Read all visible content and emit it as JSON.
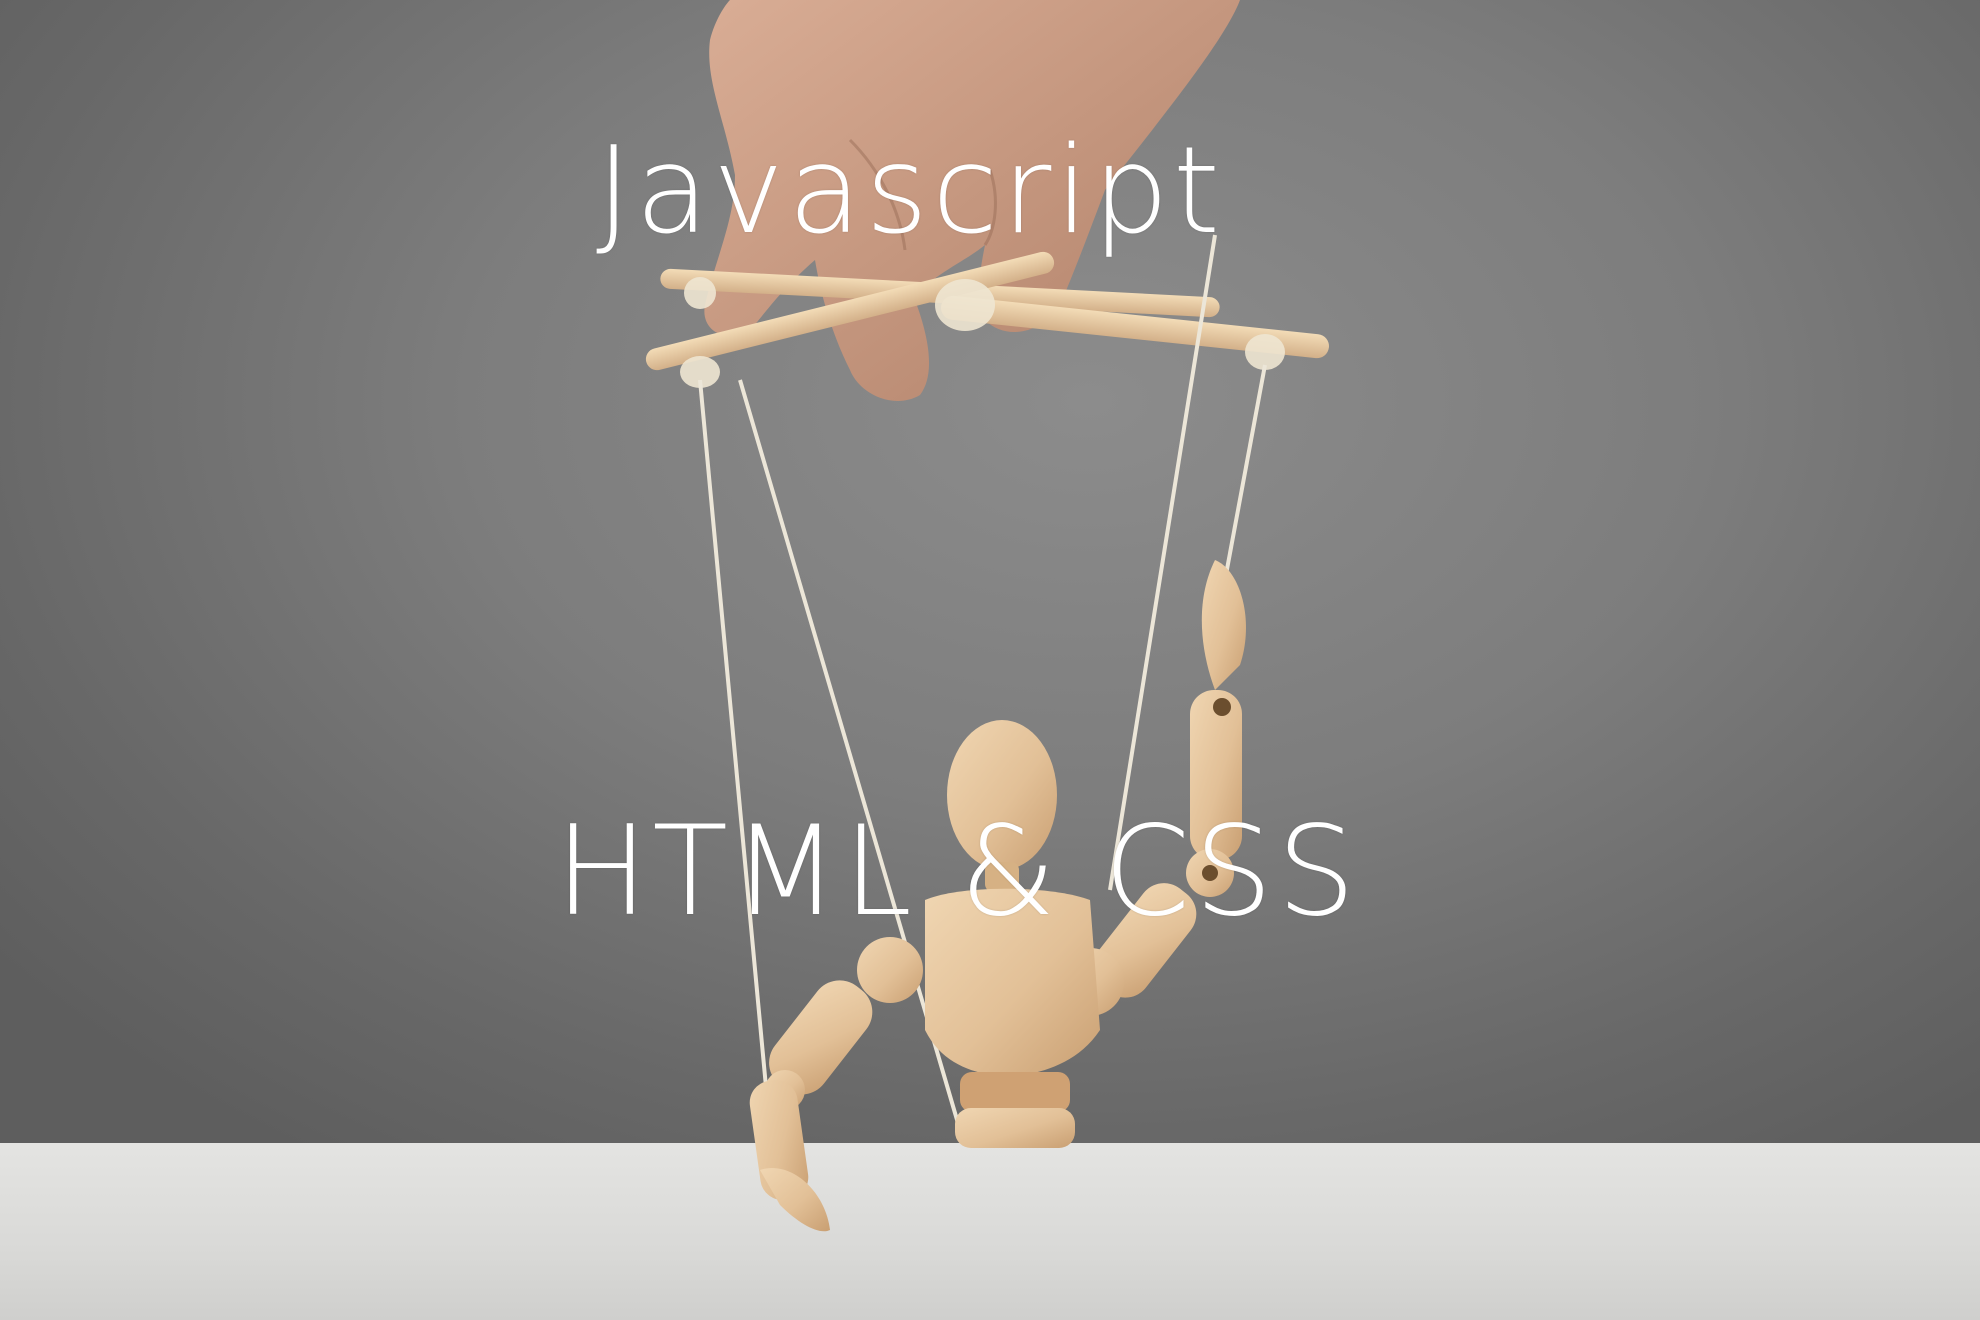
{
  "captions": {
    "top": "Javascript",
    "bottom": "HTML & CSS"
  },
  "colors": {
    "caption": "#ffffff",
    "backdrop": "#7d7d7d",
    "table": "#dcdcda",
    "wood": "#e3c39a",
    "skin": "#c89b84",
    "string": "#ece6d8"
  }
}
